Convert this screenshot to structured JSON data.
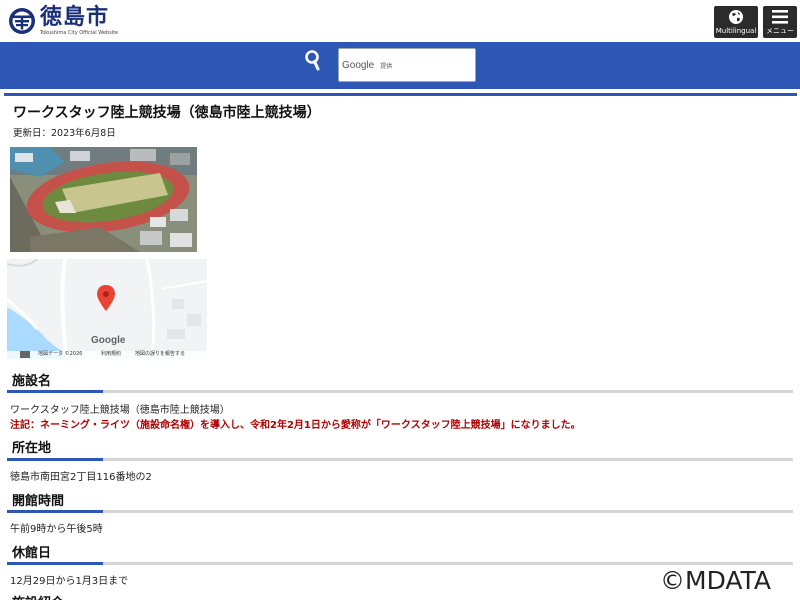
{
  "header": {
    "logo_title": "徳島市",
    "logo_subtitle": "Tokushima City Official Website",
    "multilingual_label": "Multilingual",
    "menu_label": "メニュー"
  },
  "search": {
    "google_label": "Google",
    "provider_label": "提供",
    "placeholder": ""
  },
  "page": {
    "title": "ワークスタッフ陸上競技場（徳島市陸上競技場）",
    "updated": "更新日：2023年6月8日"
  },
  "map": {
    "google_label": "Google",
    "footer_items": [
      "地図データ ©2026",
      "利用規約",
      "地図の誤りを報告する"
    ]
  },
  "sections": [
    {
      "heading": "施設名",
      "lines": [
        "ワークスタッフ陸上競技場（徳島市陸上競技場）"
      ],
      "note": "注記：ネーミング・ライツ（施設命名権）を導入し、令和2年2月1日から愛称が「ワークスタッフ陸上競技場」になりました。"
    },
    {
      "heading": "所在地",
      "lines": [
        "徳島市南田宮2丁目116番地の2"
      ]
    },
    {
      "heading": "開館時間",
      "lines": [
        "午前9時から午後5時"
      ]
    },
    {
      "heading": "休館日",
      "lines": [
        "12月29日から1月3日まで"
      ]
    },
    {
      "heading": "施設紹介"
    }
  ],
  "watermark": "©MDATA",
  "colors": {
    "brand_blue": "#2d56b5",
    "logo_navy": "#1a2f7a",
    "note_red": "#b00000",
    "button_dark": "#2b2b2b"
  },
  "icons": {
    "search": "search-icon",
    "globe": "globe-icon",
    "menu": "hamburger-icon",
    "map_pin": "map-pin-icon"
  }
}
